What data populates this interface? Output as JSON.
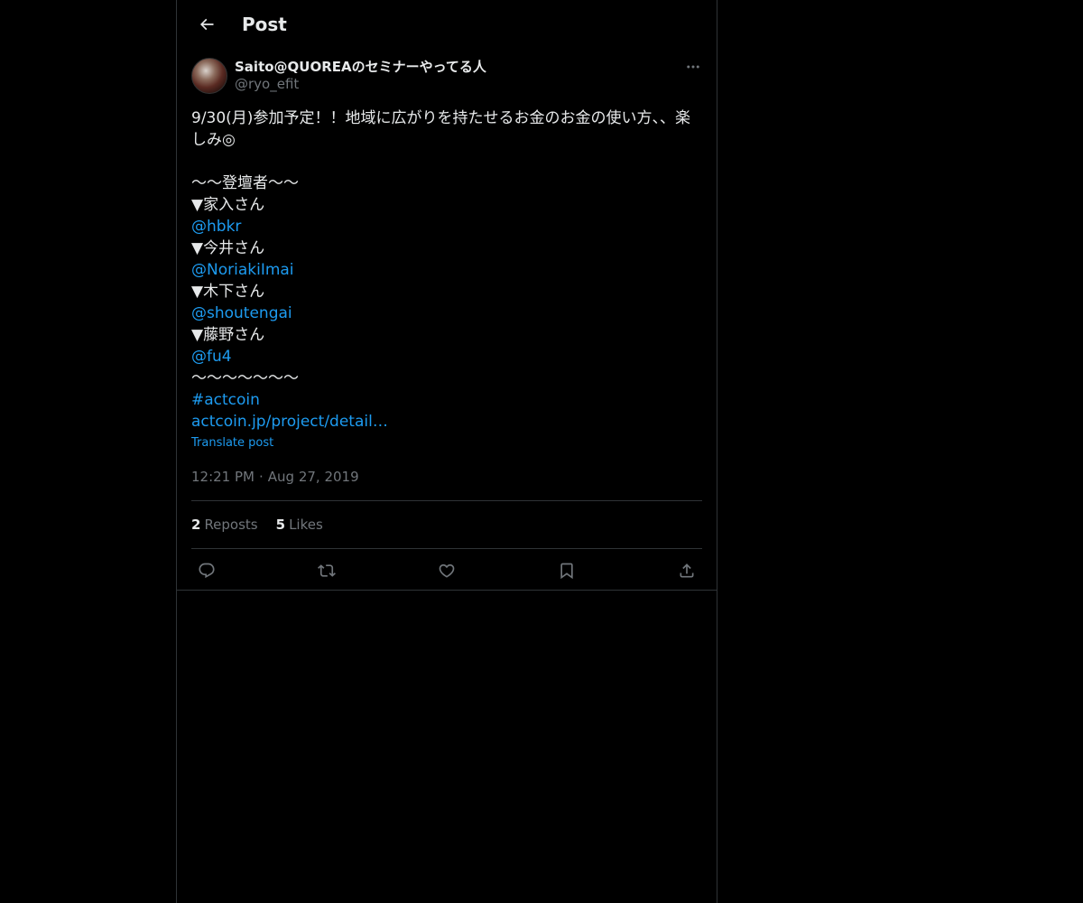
{
  "header": {
    "title": "Post"
  },
  "author": {
    "display_name": "Saito@QUOREAのセミナーやってる人",
    "handle": "@ryo_efit"
  },
  "post": {
    "lines": [
      {
        "text": "9/30(月)参加予定！！地域に広がりを持たせるお金のお金の使い方、、楽",
        "link": false
      },
      {
        "text": "しみ◎",
        "link": false
      },
      {
        "text": "",
        "link": false
      },
      {
        "text": "〜〜登壇者〜〜",
        "link": false
      },
      {
        "text": "▼家入さん",
        "link": false
      },
      {
        "text": "@hbkr",
        "link": true
      },
      {
        "text": "▼今井さん",
        "link": false
      },
      {
        "text": "@NoriakiImai",
        "link": true
      },
      {
        "text": "▼木下さん",
        "link": false
      },
      {
        "text": "@shoutengai",
        "link": true
      },
      {
        "text": "▼藤野さん",
        "link": false
      },
      {
        "text": "@fu4",
        "link": true
      },
      {
        "text": "〜〜〜〜〜〜〜",
        "link": false
      },
      {
        "text": "#actcoin",
        "link": true
      },
      {
        "text": "actcoin.jp/project/detail…",
        "link": true
      }
    ],
    "translate_label": "Translate post",
    "time": "12:21 PM",
    "date": "Aug 27, 2019",
    "separator": "·"
  },
  "stats": {
    "reposts_count": "2",
    "reposts_label": "Reposts",
    "likes_count": "5",
    "likes_label": "Likes"
  },
  "actions": [
    "reply-icon",
    "repost-icon",
    "like-icon",
    "bookmark-icon",
    "share-icon"
  ],
  "colors": {
    "background": "#000000",
    "text": "#e7e9ea",
    "muted": "#71767b",
    "link": "#1d9bf0",
    "border": "#2f3336"
  }
}
